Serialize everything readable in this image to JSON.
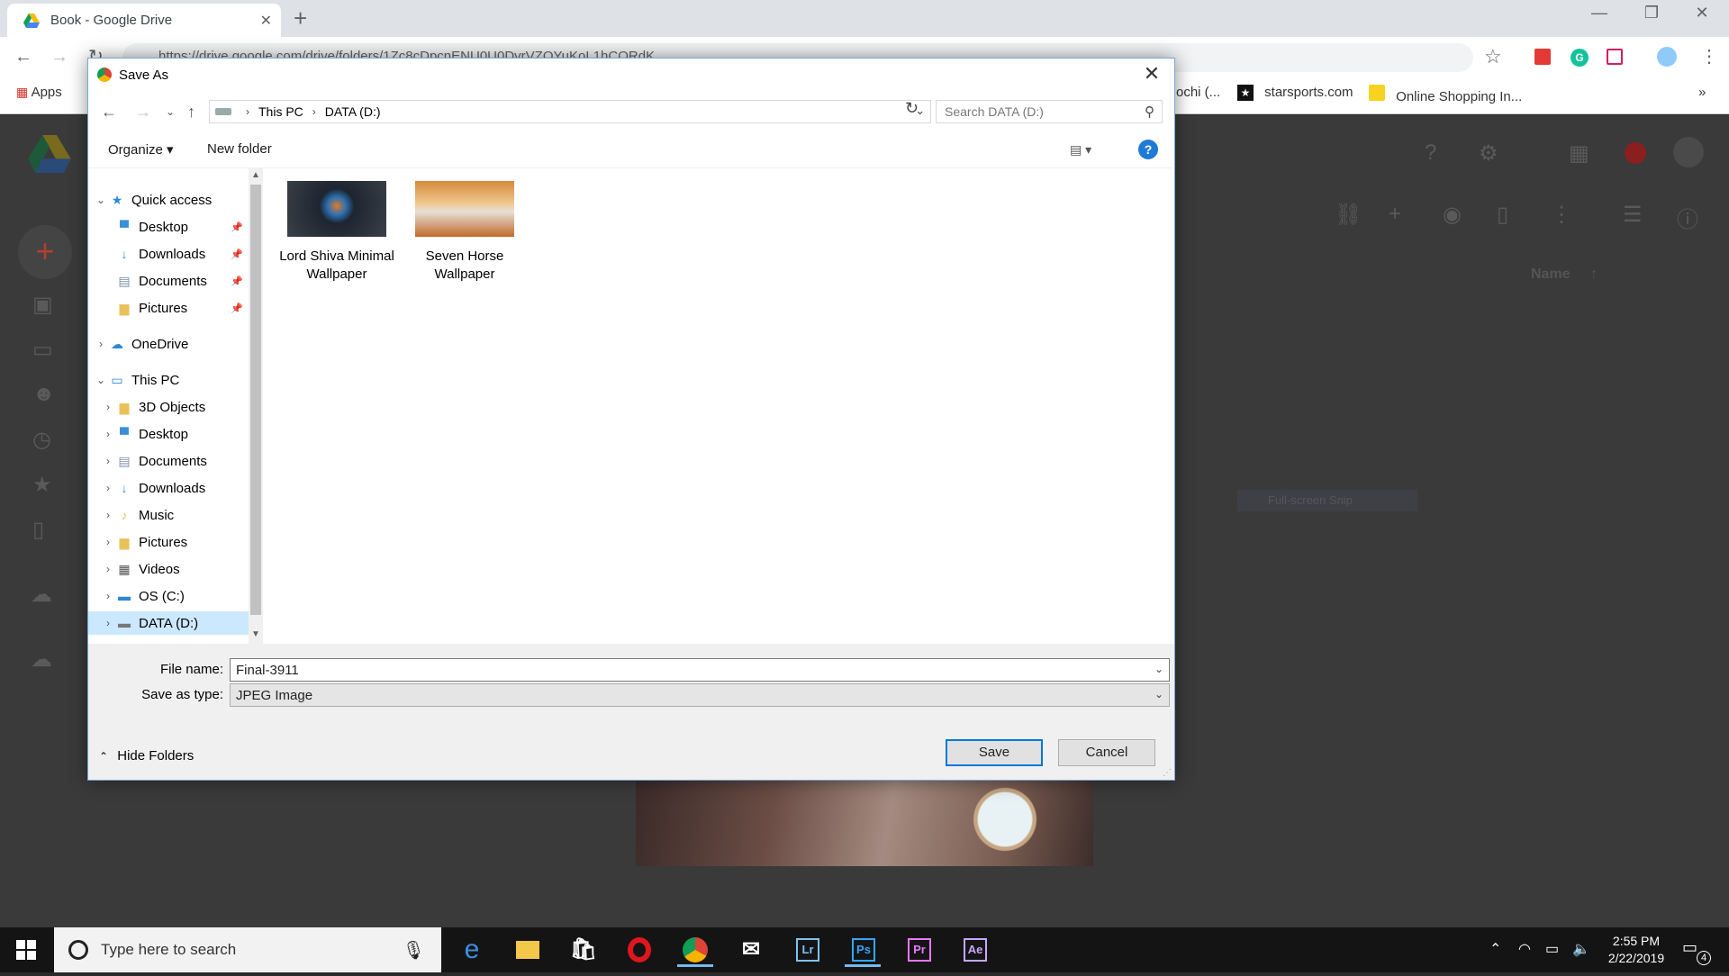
{
  "browser": {
    "tab_title": "Book - Google Drive",
    "url": "https://drive.google.com/drive/folders/1Zc8cDpcnENU0U0DvrVZOYuKoL1hCORdK",
    "apps_label": "Apps",
    "bookmarks": [
      "ochi (...",
      "starsports.com",
      "Online Shopping In..."
    ],
    "more_bookmarks": "»"
  },
  "drive": {
    "name_header": "Name",
    "snip_label": "Full-screen Snip"
  },
  "dialog": {
    "title": "Save As",
    "breadcrumb": [
      "This PC",
      "DATA (D:)"
    ],
    "search_placeholder": "Search DATA (D:)",
    "organize_label": "Organize ▾",
    "new_folder_label": "New folder",
    "tree": {
      "quick_access": "Quick access",
      "quick_items": [
        "Desktop",
        "Downloads",
        "Documents",
        "Pictures"
      ],
      "onedrive": "OneDrive",
      "this_pc": "This PC",
      "pc_items": [
        "3D Objects",
        "Desktop",
        "Documents",
        "Downloads",
        "Music",
        "Pictures",
        "Videos",
        "OS (C:)",
        "DATA (D:)"
      ]
    },
    "files": [
      {
        "name": "Lord Shiva Minimal Wallpaper"
      },
      {
        "name": "Seven Horse Wallpaper"
      }
    ],
    "file_name_label": "File name:",
    "file_name_value": "Final-3911",
    "save_type_label": "Save as type:",
    "save_type_value": "JPEG Image",
    "save_label": "Save",
    "cancel_label": "Cancel",
    "hide_folders_label": "Hide Folders"
  },
  "taskbar": {
    "search_placeholder": "Type here to search",
    "apps": [
      "Lr",
      "Ps",
      "Pr",
      "Ae"
    ],
    "time": "2:55 PM",
    "date": "2/22/2019",
    "notification_count": "4"
  },
  "colors": {
    "accent": "#0078d7",
    "dialog_border": "#7aa6d6",
    "selection": "#cce8ff"
  }
}
